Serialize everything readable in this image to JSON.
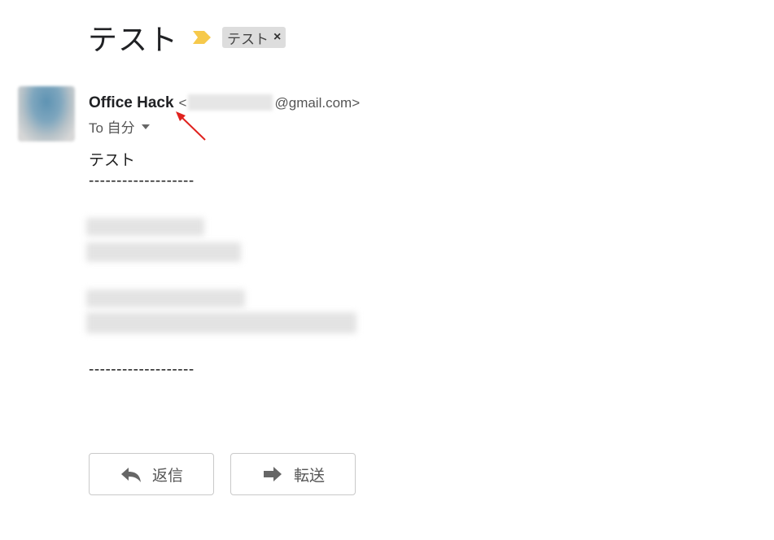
{
  "subject": "テスト",
  "label_chip": {
    "text": "テスト",
    "remove": "×"
  },
  "sender": {
    "name": "Office Hack",
    "email_open": "<",
    "email_domain": "@gmail.com>"
  },
  "recipient": {
    "label": "To 自分"
  },
  "body": {
    "first_line": "テスト",
    "separator_top": "-------------------",
    "separator_bottom": "-------------------"
  },
  "actions": {
    "reply": "返信",
    "forward": "転送"
  },
  "colors": {
    "importance": "#f6c94b",
    "annotation_arrow": "#e0221e"
  },
  "icons": {
    "importance": "importance-marker-icon",
    "reply": "reply-arrow-icon",
    "forward": "forward-arrow-icon",
    "dropdown": "caret-down-icon"
  }
}
